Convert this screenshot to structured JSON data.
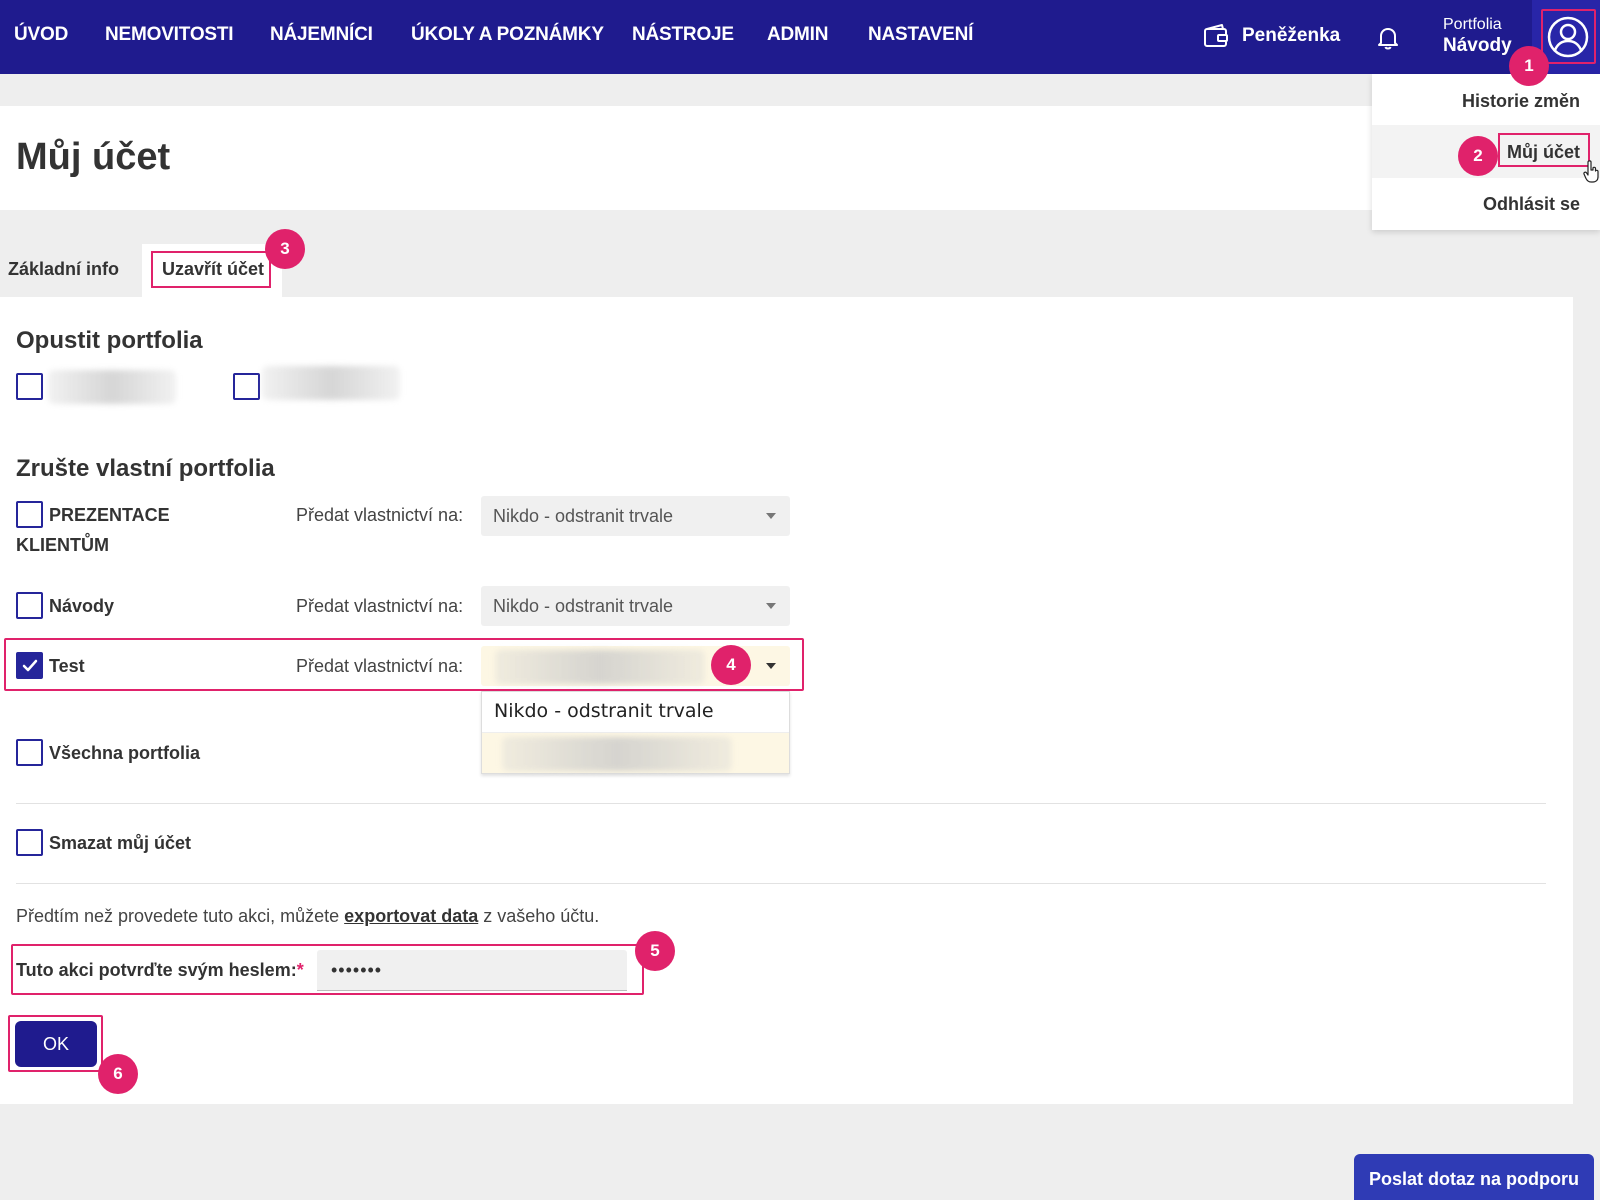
{
  "nav": {
    "items": [
      "ÚVOD",
      "NEMOVITOSTI",
      "NÁJEMNÍCI",
      "ÚKOLY A POZNÁMKY",
      "NÁSTROJE",
      "ADMIN",
      "NASTAVENÍ"
    ],
    "wallet_label": "Peněženka",
    "portfolio_caption": "Portfolia",
    "portfolio_name": "Návody"
  },
  "user_menu": {
    "items": [
      "Historie změn",
      "Můj účet",
      "Odhlásit se"
    ],
    "active": "Můj účet"
  },
  "page": {
    "title": "Můj účet",
    "tabs": [
      "Základní info",
      "Uzavřít účet"
    ],
    "active_tab": "Uzavřít účet"
  },
  "leave_portfolios": {
    "title": "Opustit portfolia",
    "items": [
      {
        "label": "",
        "checked": false,
        "redacted": true
      },
      {
        "label": "",
        "checked": false,
        "redacted": true
      }
    ]
  },
  "cancel_portfolios": {
    "title": "Zrušte vlastní portfolia",
    "transfer_label": "Předat vlastnictví na:",
    "rows": [
      {
        "name_line1": "PREZENTACE",
        "name_line2": "KLIENTŮM",
        "checked": false,
        "transfer_to": "Nikdo - odstranit trvale"
      },
      {
        "name_line1": "Návody",
        "name_line2": "",
        "checked": false,
        "transfer_to": "Nikdo - odstranit trvale"
      },
      {
        "name_line1": "Test",
        "name_line2": "",
        "checked": true,
        "transfer_to": "",
        "dropdown_open": true
      },
      {
        "name_line1": "Všechna portfolia",
        "name_line2": "",
        "checked": false
      }
    ],
    "dropdown_options": [
      "Nikdo - odstranit trvale",
      ""
    ]
  },
  "delete_account": {
    "label": "Smazat můj účet",
    "checked": false
  },
  "hint": {
    "before": "Předtím než provedete tuto akci, můžete ",
    "link": "exportovat data",
    "after": " z vašeho účtu."
  },
  "password": {
    "label": "Tuto akci potvrďte svým heslem:",
    "required_mark": "*",
    "value": "•••••••"
  },
  "ok_label": "OK",
  "support_label": "Poslat dotaz na podporu",
  "steps": [
    "1",
    "2",
    "3",
    "4",
    "5",
    "6"
  ],
  "colors": {
    "nav_bg": "#1f1b8e",
    "accent": "#e0226b",
    "checkbox": "#25259a",
    "focus_bg": "#fdf7e4"
  }
}
